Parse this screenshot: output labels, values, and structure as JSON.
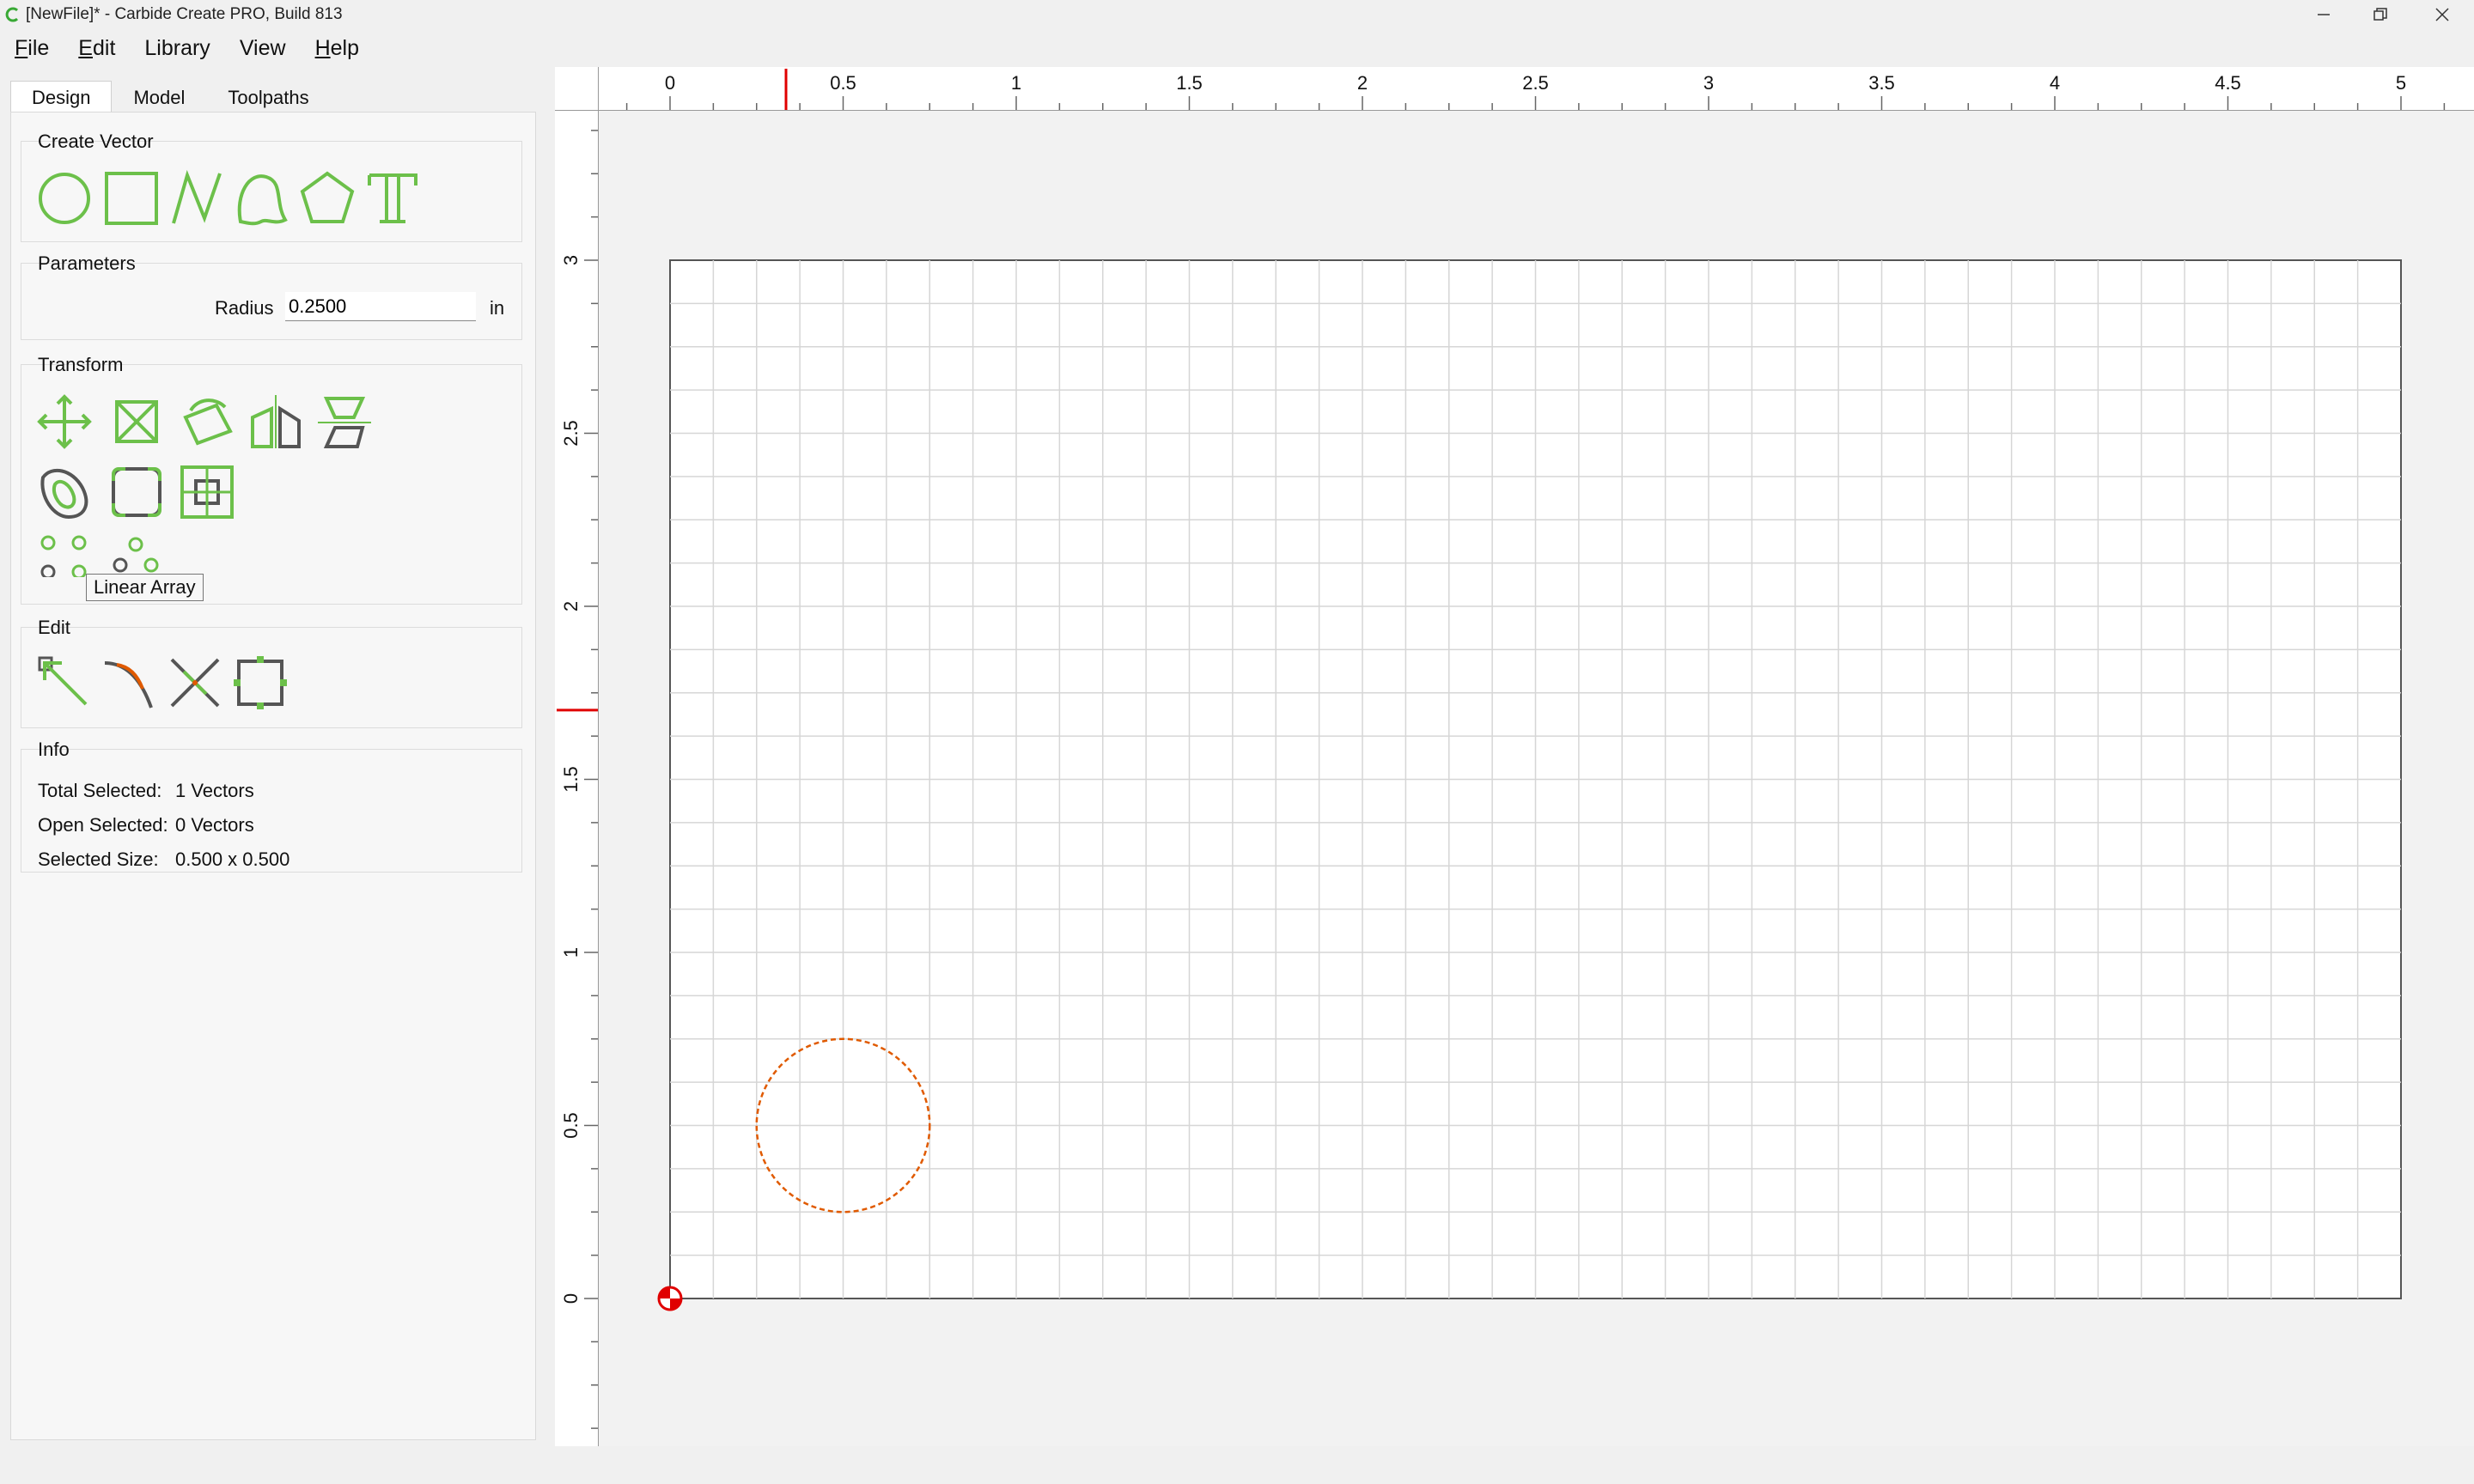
{
  "window": {
    "title": "[NewFile]* - Carbide Create PRO, Build 813",
    "minimize_icon": "minimize-icon",
    "restore_icon": "restore-icon",
    "close_icon": "close-icon"
  },
  "menu": [
    {
      "label": "File",
      "u": "F",
      "rest": "ile"
    },
    {
      "label": "Edit",
      "u": "E",
      "rest": "dit"
    },
    {
      "label": "Library",
      "u": "",
      "rest": "Library"
    },
    {
      "label": "View",
      "u": "",
      "rest": "View"
    },
    {
      "label": "Help",
      "u": "H",
      "rest": "elp"
    }
  ],
  "tabs": [
    "Design",
    "Model",
    "Toolpaths"
  ],
  "create_vector": {
    "title": "Create Vector",
    "tools": [
      "circle-icon",
      "rectangle-icon",
      "polyline-icon",
      "curve-icon",
      "polygon-icon",
      "text-icon"
    ]
  },
  "parameters": {
    "title": "Parameters",
    "radius_label": "Radius",
    "radius_value": "0.2500",
    "unit": "in"
  },
  "transform": {
    "title": "Transform",
    "tooltip": "Linear Array"
  },
  "edit": {
    "title": "Edit"
  },
  "info": {
    "title": "Info",
    "total_selected_label": "Total Selected:",
    "total_selected_value": "1 Vectors",
    "open_selected_label": "Open Selected:",
    "open_selected_value": "0 Vectors",
    "selected_size_label": "Selected Size:",
    "selected_size_value": "0.500 x 0.500"
  },
  "ruler": {
    "x_labels": [
      "0",
      "0.5",
      "1",
      "1.5",
      "2",
      "2.5",
      "3",
      "3.5",
      "4",
      "4.5",
      "5"
    ],
    "y_labels": [
      "0",
      "0.5",
      "1",
      "1.5",
      "2",
      "2.5",
      "3"
    ]
  },
  "workspace": {
    "width_in": 5,
    "height_in": 3,
    "grid_step_in": 0.125,
    "circle_center_in": [
      0.5,
      0.5
    ],
    "circle_radius_in": 0.25,
    "cursor_x_in": 0.335,
    "cursor_y_in": 1.7,
    "selection_color": "#e05a00",
    "accent_color": "#6cc04a"
  }
}
